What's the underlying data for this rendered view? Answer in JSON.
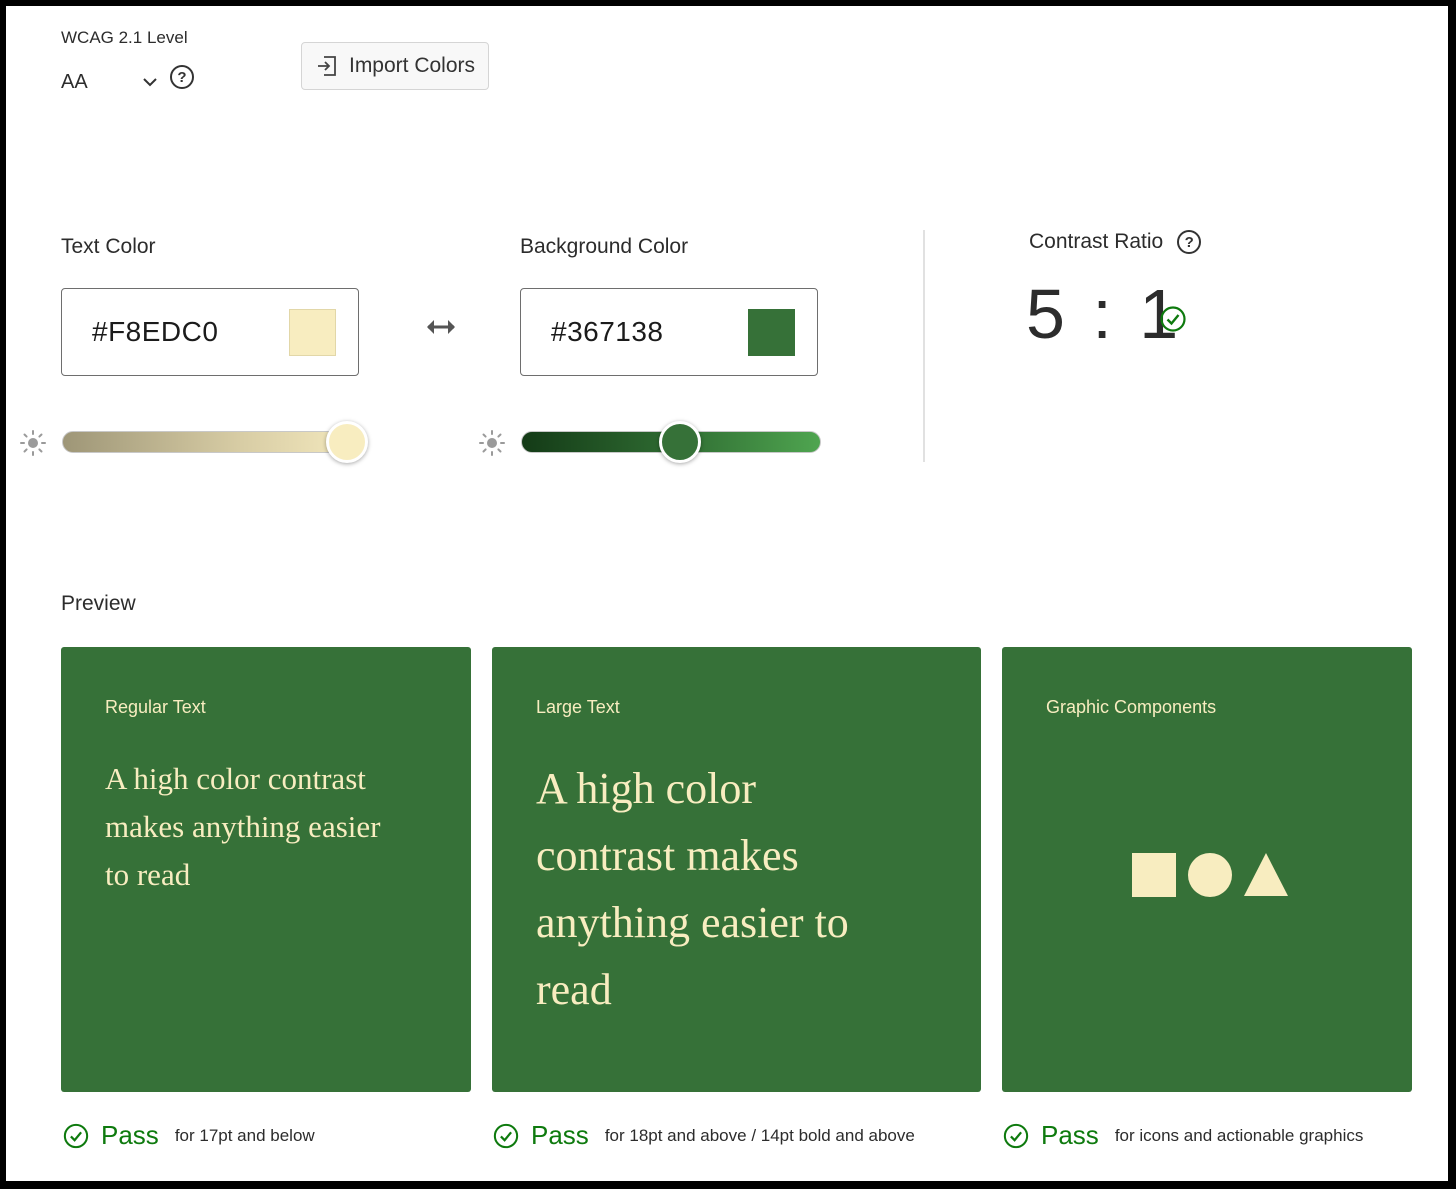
{
  "wcag": {
    "label": "WCAG 2.1 Level",
    "value": "AA"
  },
  "import_button": {
    "label": "Import Colors"
  },
  "text_color": {
    "label": "Text Color",
    "hex": "#F8EDC0",
    "swatch": "#F8EDC0",
    "lightness_level": 0.95
  },
  "background_color": {
    "label": "Background Color",
    "hex": "#367138",
    "swatch": "#367138",
    "lightness_level": 0.53
  },
  "contrast": {
    "label": "Contrast Ratio",
    "value": "5 : 1",
    "status_icon": "check-circle-icon"
  },
  "preview": {
    "label": "Preview",
    "cards": [
      {
        "title": "Regular Text",
        "sample": "A high color contrast makes anything easier to read"
      },
      {
        "title": "Large Text",
        "sample": "A high color contrast makes anything easier to read"
      },
      {
        "title": "Graphic Components",
        "shapes": [
          "square",
          "circle",
          "triangle"
        ]
      }
    ]
  },
  "results": [
    {
      "status": "Pass",
      "desc": "for 17pt and below"
    },
    {
      "status": "Pass",
      "desc": "for 18pt and above / 14pt bold and above"
    },
    {
      "status": "Pass",
      "desc": "for icons and actionable graphics"
    }
  ],
  "colors": {
    "foreground": "#F8EDC0",
    "background": "#367138",
    "pass": "#0E7A0E"
  }
}
